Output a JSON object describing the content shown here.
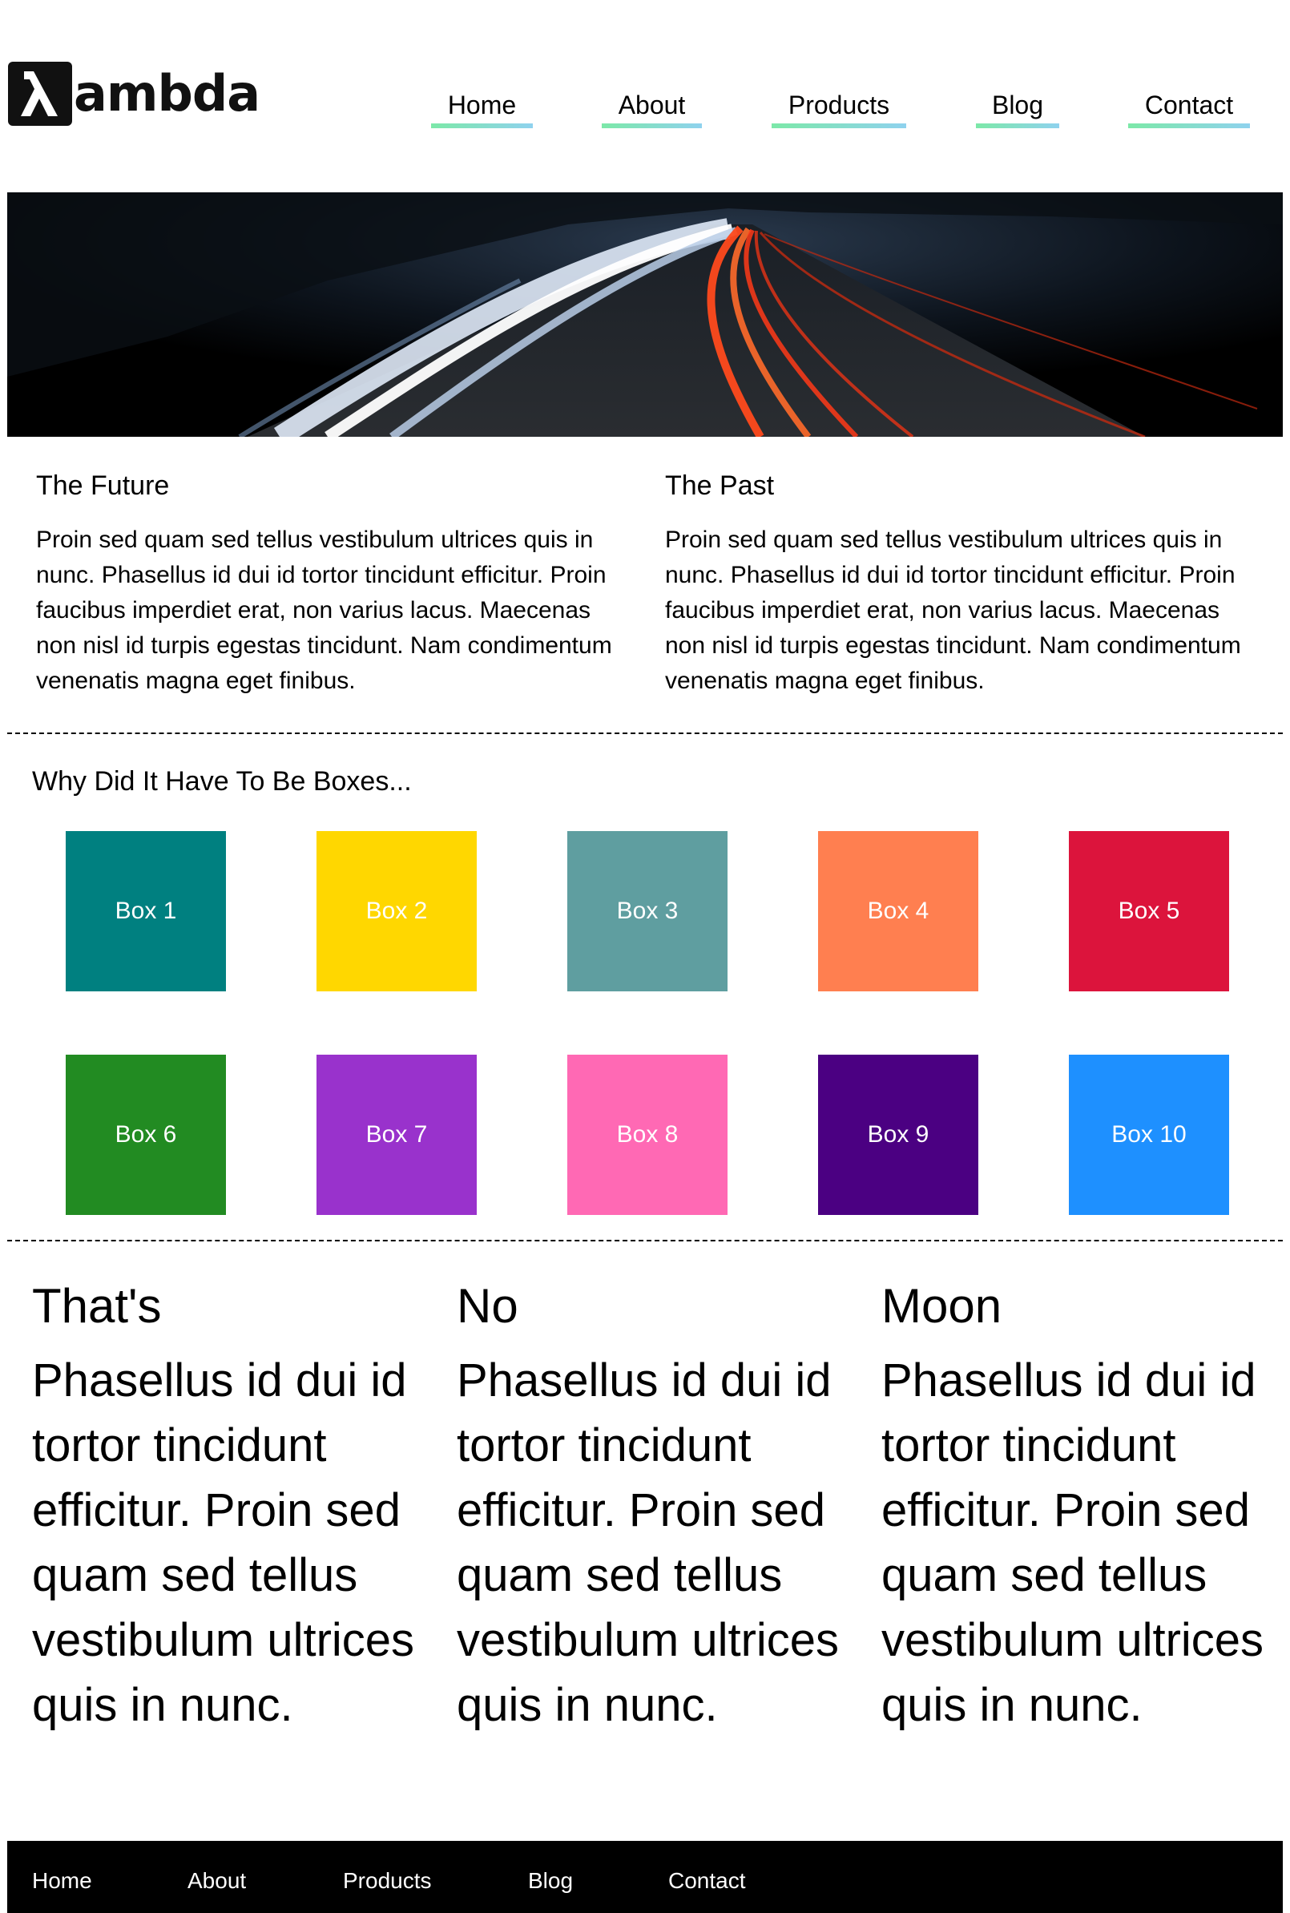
{
  "header": {
    "logo": {
      "icon": "lambda-icon",
      "text": "ambda"
    },
    "nav": [
      {
        "label": "Home"
      },
      {
        "label": "About"
      },
      {
        "label": "Products"
      },
      {
        "label": "Blog"
      },
      {
        "label": "Contact"
      }
    ]
  },
  "hero": {
    "image": "night-highway-light-trails"
  },
  "intro": {
    "left": {
      "title": "The Future",
      "body": "Proin sed quam sed tellus vestibulum ultrices quis in nunc. Phasellus id dui id tortor tincidunt efficitur. Proin faucibus imperdiet erat, non varius lacus. Maecenas non nisl id turpis egestas tincidunt. Nam condimentum venenatis magna eget finibus."
    },
    "right": {
      "title": "The Past",
      "body": "Proin sed quam sed tellus vestibulum ultrices quis in nunc. Phasellus id dui id tortor tincidunt efficitur. Proin faucibus imperdiet erat, non varius lacus. Maecenas non nisl id turpis egestas tincidunt. Nam condimentum venenatis magna eget finibus."
    }
  },
  "boxes": {
    "title": "Why Did It Have To Be Boxes...",
    "items": [
      {
        "label": "Box 1",
        "color": "#008080"
      },
      {
        "label": "Box 2",
        "color": "#FFD700"
      },
      {
        "label": "Box 3",
        "color": "#5F9EA0"
      },
      {
        "label": "Box 4",
        "color": "#FF7F50"
      },
      {
        "label": "Box 5",
        "color": "#DC143C"
      },
      {
        "label": "Box 6",
        "color": "#228B22"
      },
      {
        "label": "Box 7",
        "color": "#9932CC"
      },
      {
        "label": "Box 8",
        "color": "#FF69B4"
      },
      {
        "label": "Box 9",
        "color": "#4B0082"
      },
      {
        "label": "Box 10",
        "color": "#1E90FF"
      }
    ]
  },
  "columns": [
    {
      "title": "That's",
      "body": "Phasellus id dui id tortor tincidunt efficitur. Proin sed quam sed tellus vestibulum ultrices quis in nunc."
    },
    {
      "title": "No",
      "body": "Phasellus id dui id tortor tincidunt efficitur. Proin sed quam sed tellus vestibulum ultrices quis in nunc."
    },
    {
      "title": "Moon",
      "body": "Phasellus id dui id tortor tincidunt efficitur. Proin sed quam sed tellus vestibulum ultrices quis in nunc."
    }
  ],
  "footer": {
    "nav": [
      {
        "label": "Home"
      },
      {
        "label": "About"
      },
      {
        "label": "Products"
      },
      {
        "label": "Blog"
      },
      {
        "label": "Contact"
      }
    ]
  },
  "colors": {
    "nav_underline_start": "#7ce8a8",
    "nav_underline_end": "#8fd2ee",
    "footer_bg": "#000000",
    "hero_bg": "#000000"
  }
}
